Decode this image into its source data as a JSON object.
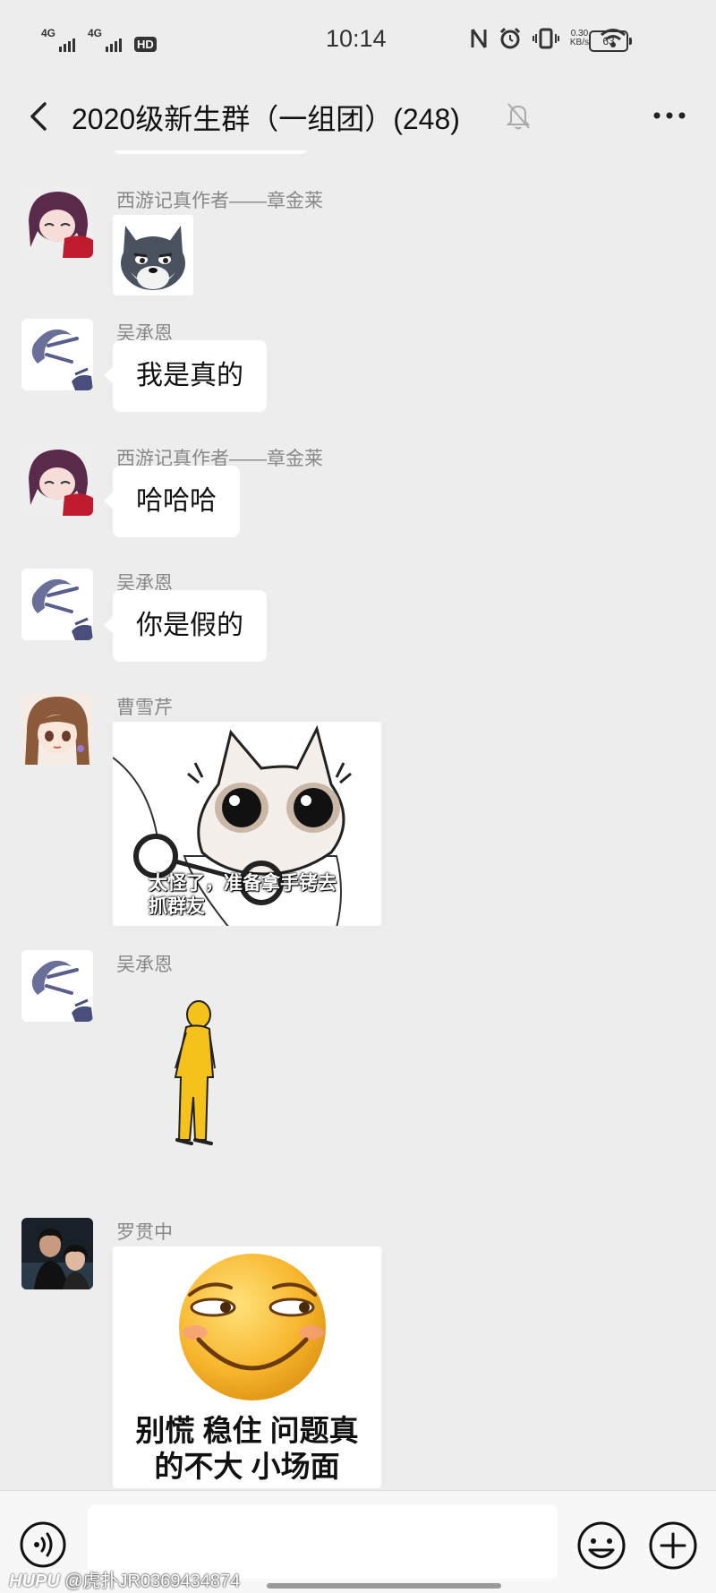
{
  "status_bar": {
    "signal1": "4G",
    "signal2": "4G",
    "hd": "HD",
    "time": "10:14",
    "net_speed_value": "0.30",
    "net_speed_unit": "KB/s",
    "battery": "63"
  },
  "nav": {
    "title": "2020级新生群（一组团）(248)"
  },
  "messages": [
    {
      "sender": "西游记真作者——章金莱",
      "type": "sticker",
      "sticker": "husky-dog-sticker"
    },
    {
      "sender": "吴承恩",
      "type": "text",
      "text": "我是真的"
    },
    {
      "sender": "西游记真作者——章金莱",
      "type": "text",
      "text": "哈哈哈"
    },
    {
      "sender": "吴承恩",
      "type": "text",
      "text": "你是假的"
    },
    {
      "sender": "曹雪芹",
      "type": "sticker",
      "sticker": "cat-handcuffs-sticker",
      "caption_line1": "太怪了，准备拿手铐去",
      "caption_line2": "抓群友"
    },
    {
      "sender": "吴承恩",
      "type": "sticker",
      "sticker": "yellow-figure-sticker"
    },
    {
      "sender": "罗贯中",
      "type": "sticker",
      "sticker": "smirk-emoji-sticker",
      "caption_line1": "别慌 稳住 问题真",
      "caption_line2": "的不大 小场面"
    }
  ],
  "input_bar": {
    "placeholder": "",
    "watermark_brand": "HUPU",
    "watermark_user": "@虎扑JR0369434874"
  },
  "colors": {
    "background": "#ededed",
    "bubble": "#ffffff",
    "sender_text": "#888888",
    "input_bar": "#f7f7f7"
  }
}
